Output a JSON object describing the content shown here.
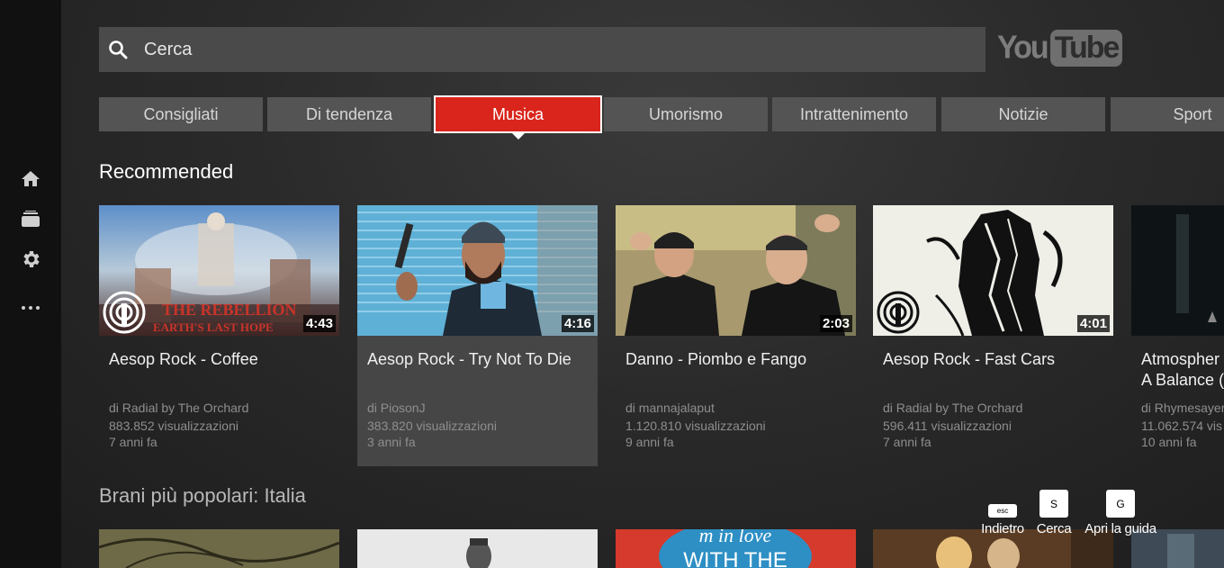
{
  "search": {
    "placeholder": "Cerca",
    "icon": "search-icon"
  },
  "logo": {
    "you": "You",
    "tube": "Tube"
  },
  "sidebar": {
    "items": [
      "home-icon",
      "subscriptions-icon",
      "settings-icon",
      "more-icon"
    ]
  },
  "tabs": [
    {
      "label": "Consigliati"
    },
    {
      "label": "Di tendenza"
    },
    {
      "label": "Musica",
      "active": true
    },
    {
      "label": "Umorismo"
    },
    {
      "label": "Intrattenimento"
    },
    {
      "label": "Notizie"
    },
    {
      "label": "Sport"
    }
  ],
  "sections": {
    "recommended": "Recommended",
    "popular": "Brani più popolari: Italia"
  },
  "videos": [
    {
      "title": "Aesop Rock - Coffee",
      "channel": "di Radial by The Orchard",
      "views": "883.852 visualizzazioni",
      "age": "7 anni fa",
      "duration": "4:43",
      "overlay_text_1": "THE REBELLION",
      "overlay_text_2": "EARTH'S LAST HOPE"
    },
    {
      "title": "Aesop Rock - Try Not To Die",
      "channel": "di PiosonJ",
      "views": "383.820 visualizzazioni",
      "age": "3 anni fa",
      "duration": "4:16"
    },
    {
      "title": "Danno - Piombo e Fango",
      "channel": "di mannajalaput",
      "views": "1.120.810 visualizzazioni",
      "age": "9 anni fa",
      "duration": "2:03"
    },
    {
      "title": "Aesop Rock - Fast Cars",
      "channel": "di Radial by The Orchard",
      "views": "596.411 visualizzazioni",
      "age": "7 anni fa",
      "duration": "4:01"
    },
    {
      "title": "Atmospher",
      "title2": "A Balance (",
      "channel": "di Rhymesayer",
      "views": "11.062.574 vis",
      "age": "10 anni fa"
    }
  ],
  "row2_thumb_text": [
    "m in love",
    "WITH THE"
  ],
  "hints": [
    {
      "key": "esc",
      "label": "Indietro"
    },
    {
      "key": "S",
      "label": "Cerca"
    },
    {
      "key": "G",
      "label": "Apri la guida"
    }
  ],
  "colors": {
    "accent": "#d9251c",
    "background": "#2a2a2a",
    "sidebar": "#111111"
  }
}
